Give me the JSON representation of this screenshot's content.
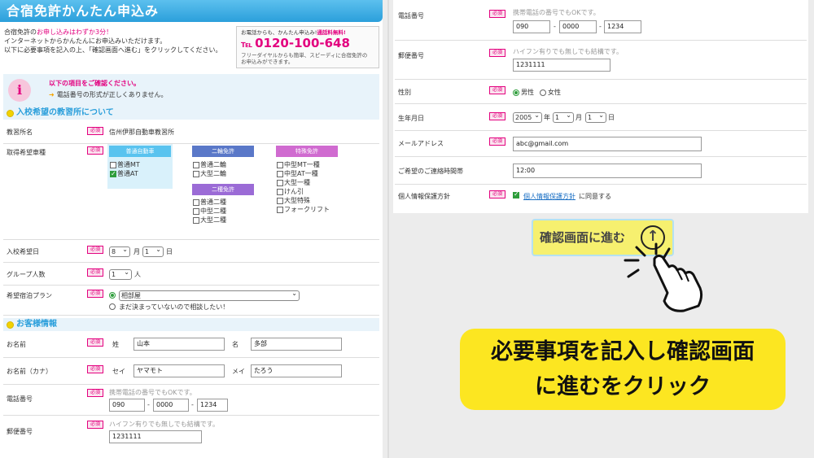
{
  "left": {
    "title": "合宿免許かんたん申込み",
    "intro1_pre": "合宿免許の",
    "intro1_hl": "お申し込みはわずか3分！",
    "intro2": "インターネットからかんたんにお申込みいただけます。",
    "intro3": "以下に必要事項を記入の上、「確認画面へ進む」をクリックしてください。",
    "phone_top": "お電話からも、かんたん申込み!",
    "phone_free": "通話料無料!",
    "phone_number": "0120-100-648",
    "phone_note1": "フリーダイヤルからも簡単、スピーディに合宿免許の",
    "phone_note2": "お申込みができます。",
    "notice_badge": "i",
    "notice_head": "以下の項目をご確認ください。",
    "notice_msg": "電話番号の形式が正しくありません。",
    "section1": "入校希望の教習所について",
    "school_label": "教習所名",
    "school_value": "信州伊那自動車教習所",
    "license_label": "取得希望車種",
    "type_car": "普通自動車",
    "type_bike": "二輪免許",
    "type_special": "特殊免許",
    "type_bike2": "二種免許",
    "car_opts": [
      "普通MT",
      "普通AT"
    ],
    "bike_opts": [
      "普通二輪",
      "大型二輪"
    ],
    "special_opts": [
      "中型MT一種",
      "中型AT一種",
      "大型一種",
      "けん引",
      "大型特殊",
      "フォークリフト"
    ],
    "bike2_opts": [
      "普通二種",
      "中型二種",
      "大型二種"
    ],
    "entry_label": "入校希望日",
    "entry_month": "8",
    "entry_month_unit": "月",
    "entry_day": "1",
    "entry_day_unit": "日",
    "group_label": "グループ人数",
    "group_value": "1",
    "group_unit": "人",
    "plan_label": "希望宿泊プラン",
    "plan_selected": "相部屋",
    "plan_undecided": "まだ決まっていないので相談したい！",
    "section2": "お客様情報",
    "name_label": "お名前",
    "sei": "姓",
    "mei": "名",
    "name_sei": "山本",
    "name_mei": "多部",
    "kana_label": "お名前（カナ）",
    "kana_sei_l": "セイ",
    "kana_mei_l": "メイ",
    "kana_sei": "ヤマモト",
    "kana_mei": "たろう",
    "tel_label": "電話番号",
    "tel_hint": "携帯電話の番号でもOKです。",
    "tel1": "090",
    "tel2": "0000",
    "tel3": "1234",
    "dash": "-",
    "zip_label": "郵便番号",
    "zip_hint": "ハイフン有りでも無しでも結構です。",
    "zip": "1231111",
    "required": "必須"
  },
  "right": {
    "tel_label": "電話番号",
    "tel_hint": "携帯電話の番号でもOKです。",
    "tel1": "090",
    "tel2": "0000",
    "tel3": "1234",
    "zip_label": "郵便番号",
    "zip_hint": "ハイフン有りでも無しでも結構です。",
    "zip": "1231111",
    "gender_label": "性別",
    "male": "男性",
    "female": "女性",
    "birth_label": "生年月日",
    "birth_year": "2005",
    "year_unit": "年",
    "birth_month": "1",
    "month_unit": "月",
    "birth_day": "1",
    "day_unit": "日",
    "email_label": "メールアドレス",
    "email": "abc@gmail.com",
    "contact_label": "ご希望のご連絡時間帯",
    "contact": "12:00",
    "privacy_label": "個人情報保護方針",
    "privacy_link": "個人情報保護方針",
    "privacy_text": "に同意する",
    "confirm_button": "確認画面に進む",
    "callout1": "必要事項を記入し確認画面",
    "callout2": "に進むをクリック"
  },
  "colors": {
    "accent": "#2b9fdb",
    "pink": "#e3007f",
    "callout": "#fce621",
    "car": "#59c3ef",
    "bike": "#5a78c8",
    "special": "#d06bd0",
    "bike2": "#9b6bd6"
  }
}
